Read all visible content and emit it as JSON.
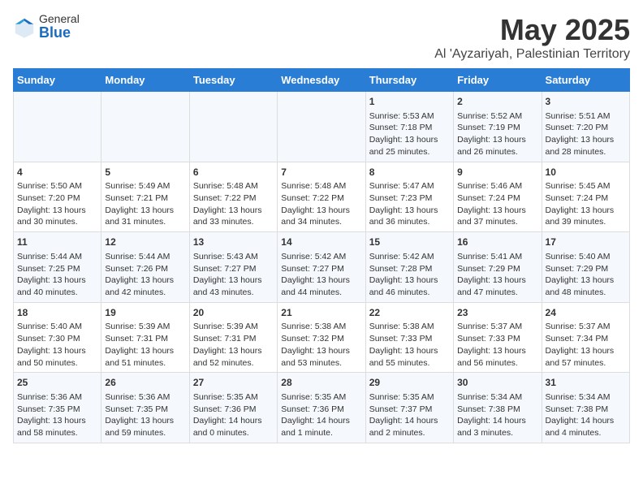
{
  "logo": {
    "general": "General",
    "blue": "Blue"
  },
  "title": "May 2025",
  "subtitle": "Al 'Ayzariyah, Palestinian Territory",
  "weekdays": [
    "Sunday",
    "Monday",
    "Tuesday",
    "Wednesday",
    "Thursday",
    "Friday",
    "Saturday"
  ],
  "weeks": [
    [
      {
        "day": "",
        "info": ""
      },
      {
        "day": "",
        "info": ""
      },
      {
        "day": "",
        "info": ""
      },
      {
        "day": "",
        "info": ""
      },
      {
        "day": "1",
        "info": "Sunrise: 5:53 AM\nSunset: 7:18 PM\nDaylight: 13 hours\nand 25 minutes."
      },
      {
        "day": "2",
        "info": "Sunrise: 5:52 AM\nSunset: 7:19 PM\nDaylight: 13 hours\nand 26 minutes."
      },
      {
        "day": "3",
        "info": "Sunrise: 5:51 AM\nSunset: 7:20 PM\nDaylight: 13 hours\nand 28 minutes."
      }
    ],
    [
      {
        "day": "4",
        "info": "Sunrise: 5:50 AM\nSunset: 7:20 PM\nDaylight: 13 hours\nand 30 minutes."
      },
      {
        "day": "5",
        "info": "Sunrise: 5:49 AM\nSunset: 7:21 PM\nDaylight: 13 hours\nand 31 minutes."
      },
      {
        "day": "6",
        "info": "Sunrise: 5:48 AM\nSunset: 7:22 PM\nDaylight: 13 hours\nand 33 minutes."
      },
      {
        "day": "7",
        "info": "Sunrise: 5:48 AM\nSunset: 7:22 PM\nDaylight: 13 hours\nand 34 minutes."
      },
      {
        "day": "8",
        "info": "Sunrise: 5:47 AM\nSunset: 7:23 PM\nDaylight: 13 hours\nand 36 minutes."
      },
      {
        "day": "9",
        "info": "Sunrise: 5:46 AM\nSunset: 7:24 PM\nDaylight: 13 hours\nand 37 minutes."
      },
      {
        "day": "10",
        "info": "Sunrise: 5:45 AM\nSunset: 7:24 PM\nDaylight: 13 hours\nand 39 minutes."
      }
    ],
    [
      {
        "day": "11",
        "info": "Sunrise: 5:44 AM\nSunset: 7:25 PM\nDaylight: 13 hours\nand 40 minutes."
      },
      {
        "day": "12",
        "info": "Sunrise: 5:44 AM\nSunset: 7:26 PM\nDaylight: 13 hours\nand 42 minutes."
      },
      {
        "day": "13",
        "info": "Sunrise: 5:43 AM\nSunset: 7:27 PM\nDaylight: 13 hours\nand 43 minutes."
      },
      {
        "day": "14",
        "info": "Sunrise: 5:42 AM\nSunset: 7:27 PM\nDaylight: 13 hours\nand 44 minutes."
      },
      {
        "day": "15",
        "info": "Sunrise: 5:42 AM\nSunset: 7:28 PM\nDaylight: 13 hours\nand 46 minutes."
      },
      {
        "day": "16",
        "info": "Sunrise: 5:41 AM\nSunset: 7:29 PM\nDaylight: 13 hours\nand 47 minutes."
      },
      {
        "day": "17",
        "info": "Sunrise: 5:40 AM\nSunset: 7:29 PM\nDaylight: 13 hours\nand 48 minutes."
      }
    ],
    [
      {
        "day": "18",
        "info": "Sunrise: 5:40 AM\nSunset: 7:30 PM\nDaylight: 13 hours\nand 50 minutes."
      },
      {
        "day": "19",
        "info": "Sunrise: 5:39 AM\nSunset: 7:31 PM\nDaylight: 13 hours\nand 51 minutes."
      },
      {
        "day": "20",
        "info": "Sunrise: 5:39 AM\nSunset: 7:31 PM\nDaylight: 13 hours\nand 52 minutes."
      },
      {
        "day": "21",
        "info": "Sunrise: 5:38 AM\nSunset: 7:32 PM\nDaylight: 13 hours\nand 53 minutes."
      },
      {
        "day": "22",
        "info": "Sunrise: 5:38 AM\nSunset: 7:33 PM\nDaylight: 13 hours\nand 55 minutes."
      },
      {
        "day": "23",
        "info": "Sunrise: 5:37 AM\nSunset: 7:33 PM\nDaylight: 13 hours\nand 56 minutes."
      },
      {
        "day": "24",
        "info": "Sunrise: 5:37 AM\nSunset: 7:34 PM\nDaylight: 13 hours\nand 57 minutes."
      }
    ],
    [
      {
        "day": "25",
        "info": "Sunrise: 5:36 AM\nSunset: 7:35 PM\nDaylight: 13 hours\nand 58 minutes."
      },
      {
        "day": "26",
        "info": "Sunrise: 5:36 AM\nSunset: 7:35 PM\nDaylight: 13 hours\nand 59 minutes."
      },
      {
        "day": "27",
        "info": "Sunrise: 5:35 AM\nSunset: 7:36 PM\nDaylight: 14 hours\nand 0 minutes."
      },
      {
        "day": "28",
        "info": "Sunrise: 5:35 AM\nSunset: 7:36 PM\nDaylight: 14 hours\nand 1 minute."
      },
      {
        "day": "29",
        "info": "Sunrise: 5:35 AM\nSunset: 7:37 PM\nDaylight: 14 hours\nand 2 minutes."
      },
      {
        "day": "30",
        "info": "Sunrise: 5:34 AM\nSunset: 7:38 PM\nDaylight: 14 hours\nand 3 minutes."
      },
      {
        "day": "31",
        "info": "Sunrise: 5:34 AM\nSunset: 7:38 PM\nDaylight: 14 hours\nand 4 minutes."
      }
    ]
  ]
}
